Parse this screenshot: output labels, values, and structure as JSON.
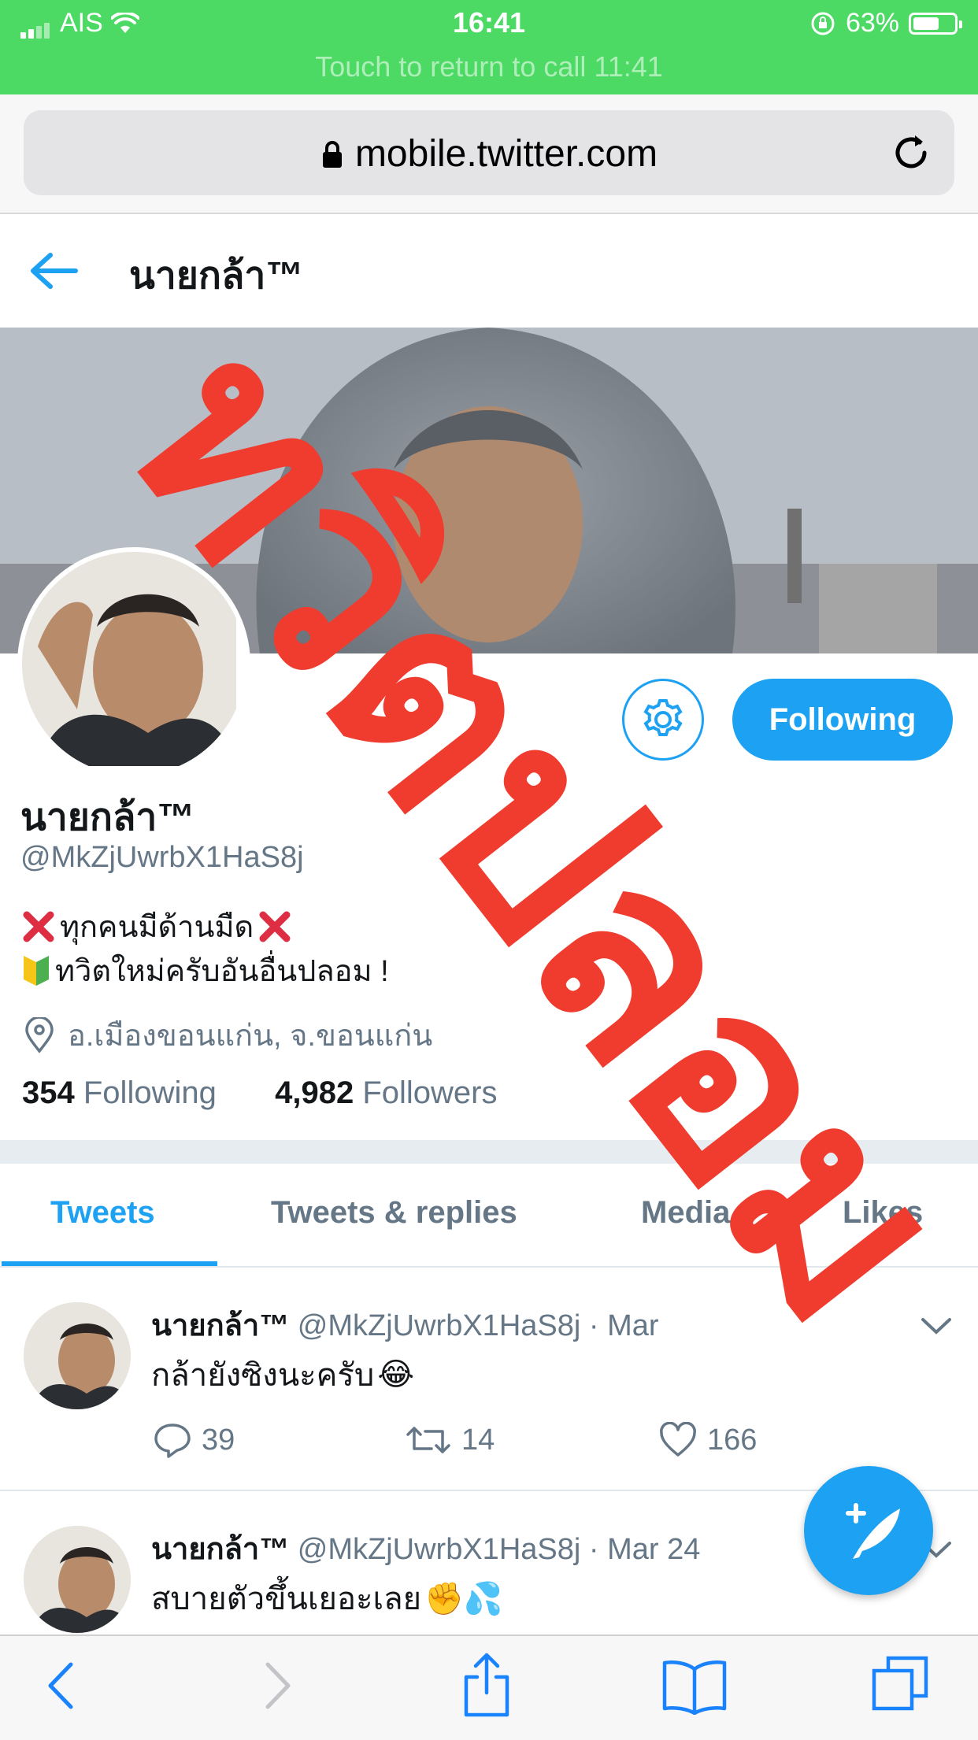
{
  "status_bar": {
    "carrier": "AIS",
    "time": "16:41",
    "battery": "63%",
    "battery_level": 0.63,
    "call_banner": "Touch to return to call 11:41"
  },
  "browser": {
    "url": "mobile.twitter.com"
  },
  "header": {
    "title": "นายกล้า™"
  },
  "profile": {
    "name": "นายกล้า™",
    "handle": "@MkZjUwrbX1HaS8j",
    "bio_line1": "ทุกคนมีด้านมืด",
    "bio_line2": "ทวิตใหม่ครับอันอื่นปลอม !",
    "location": "อ.เมืองขอนแก่น, จ.ขอนแก่น",
    "following_count": "354",
    "following_label": "Following",
    "followers_count": "4,982",
    "followers_label": "Followers",
    "follow_button": "Following"
  },
  "tabs": [
    {
      "label": "Tweets",
      "active": true
    },
    {
      "label": "Tweets & replies",
      "active": false
    },
    {
      "label": "Media",
      "active": false
    },
    {
      "label": "Likes",
      "active": false
    }
  ],
  "tweets": [
    {
      "name": "นายกล้า™",
      "handle": "@MkZjUwrbX1HaS8j",
      "date": "· Mar",
      "text": "กล้ายังซิงนะครับ",
      "emoji": "😂",
      "replies": "39",
      "retweets": "14",
      "likes": "166"
    },
    {
      "name": "นายกล้า™",
      "handle": "@MkZjUwrbX1HaS8j",
      "date": "· Mar 24",
      "text": "สบายตัวขึ้นเยอะเลย",
      "emoji": "✊💦"
    }
  ],
  "watermark": {
    "text": "ทวิตปลอม",
    "color": "#f03b2f"
  },
  "colors": {
    "status_green": "#4cd964",
    "twitter_blue": "#1da1f2",
    "gray_text": "#657786"
  }
}
